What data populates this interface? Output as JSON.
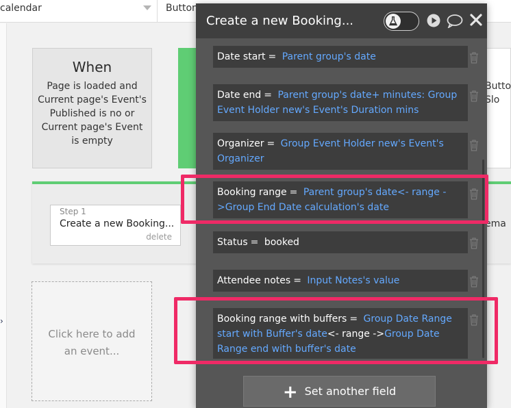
{
  "topbar": {
    "select1": "calendar",
    "select2": "Button"
  },
  "when_card": {
    "title": "When",
    "condition": "Page is loaded and Current page's Event's Published is no or Current page's Event is empty"
  },
  "step": {
    "label": "Step 1",
    "name": "Create a new Booking...",
    "delete": "delete"
  },
  "add_event": {
    "text": "Click here to add an event..."
  },
  "right_peek": {
    "card_text": "Butto Slo",
    "band_text": "ema"
  },
  "panel": {
    "title": "Create a new Booking...",
    "set_field_button": "Set another field",
    "fields": [
      {
        "name": "Date start",
        "eq": "=",
        "parts": [
          {
            "text": "Parent group's date",
            "kind": "dyn"
          }
        ]
      },
      {
        "name": "Date end",
        "eq": "=",
        "parts": [
          {
            "text": "Parent group's date+ minutes: Group Event Holder new's Event's Duration mins",
            "kind": "dyn"
          }
        ]
      },
      {
        "name": "Organizer",
        "eq": "=",
        "parts": [
          {
            "text": "Group Event Holder new's Event's Organizer",
            "kind": "dyn"
          }
        ]
      },
      {
        "name": "Booking range",
        "eq": "=",
        "parts": [
          {
            "text": "Parent group's date<- range ->Group End Date calculation's date",
            "kind": "dyn"
          }
        ]
      },
      {
        "name": "Status",
        "eq": "=",
        "parts": [
          {
            "text": "booked",
            "kind": "plain"
          }
        ]
      },
      {
        "name": "Attendee notes",
        "eq": "=",
        "parts": [
          {
            "text": "Input Notes's value",
            "kind": "dyn"
          }
        ]
      },
      {
        "name": "Booking range with buffers",
        "eq": "=",
        "parts": [
          {
            "text": "Group Date Range start with Buffer's date",
            "kind": "dyn"
          },
          {
            "text": "<- range ->",
            "kind": "plain"
          },
          {
            "text": "Group Date Range end with buffer's date",
            "kind": "dyn"
          }
        ]
      }
    ]
  },
  "colors": {
    "dynamic_text": "#64a9ff",
    "highlight": "#ef2a66",
    "accent_green": "#5fcd74",
    "panel_bg": "#565656",
    "panel_header": "#3f3f3f",
    "field_bg": "#3d3d3d"
  },
  "icons": {
    "toggle": "flask-icon",
    "play": "play-icon",
    "comment": "comment-icon",
    "close": "close-icon",
    "trash": "trash-icon",
    "plus": "plus-icon",
    "dropdown": "chevron-down-icon"
  }
}
